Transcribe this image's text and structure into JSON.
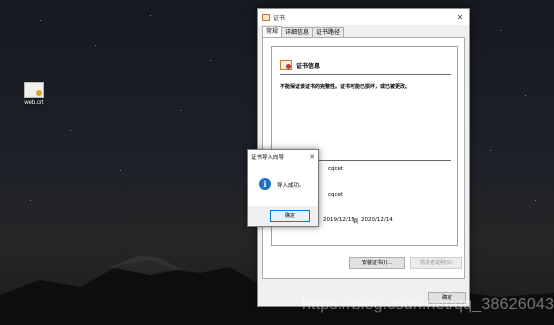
{
  "desktop": {
    "icon_label": "web.crt"
  },
  "cert_window": {
    "title": "证书",
    "tabs": [
      "常规",
      "详细信息",
      "证书路径"
    ],
    "info_title": "证书信息",
    "warning": "不能保证该证书的完整性。证书可能已损坏，或已被更改。",
    "issued_to": "cqcet",
    "issued_by": "cqcet",
    "valid_from": "2019/12/15",
    "valid_to_prefix": "到",
    "valid_to": "2020/12/14",
    "install_button": "安装证书(I)...",
    "issuer_statement_button": "颁发者说明(S)",
    "ok_button": "确定"
  },
  "import_dialog": {
    "title": "证书导入向导",
    "message": "导入成功。",
    "ok_button": "确定"
  },
  "watermark": "https://blog.csdn.net/qq_38626043"
}
